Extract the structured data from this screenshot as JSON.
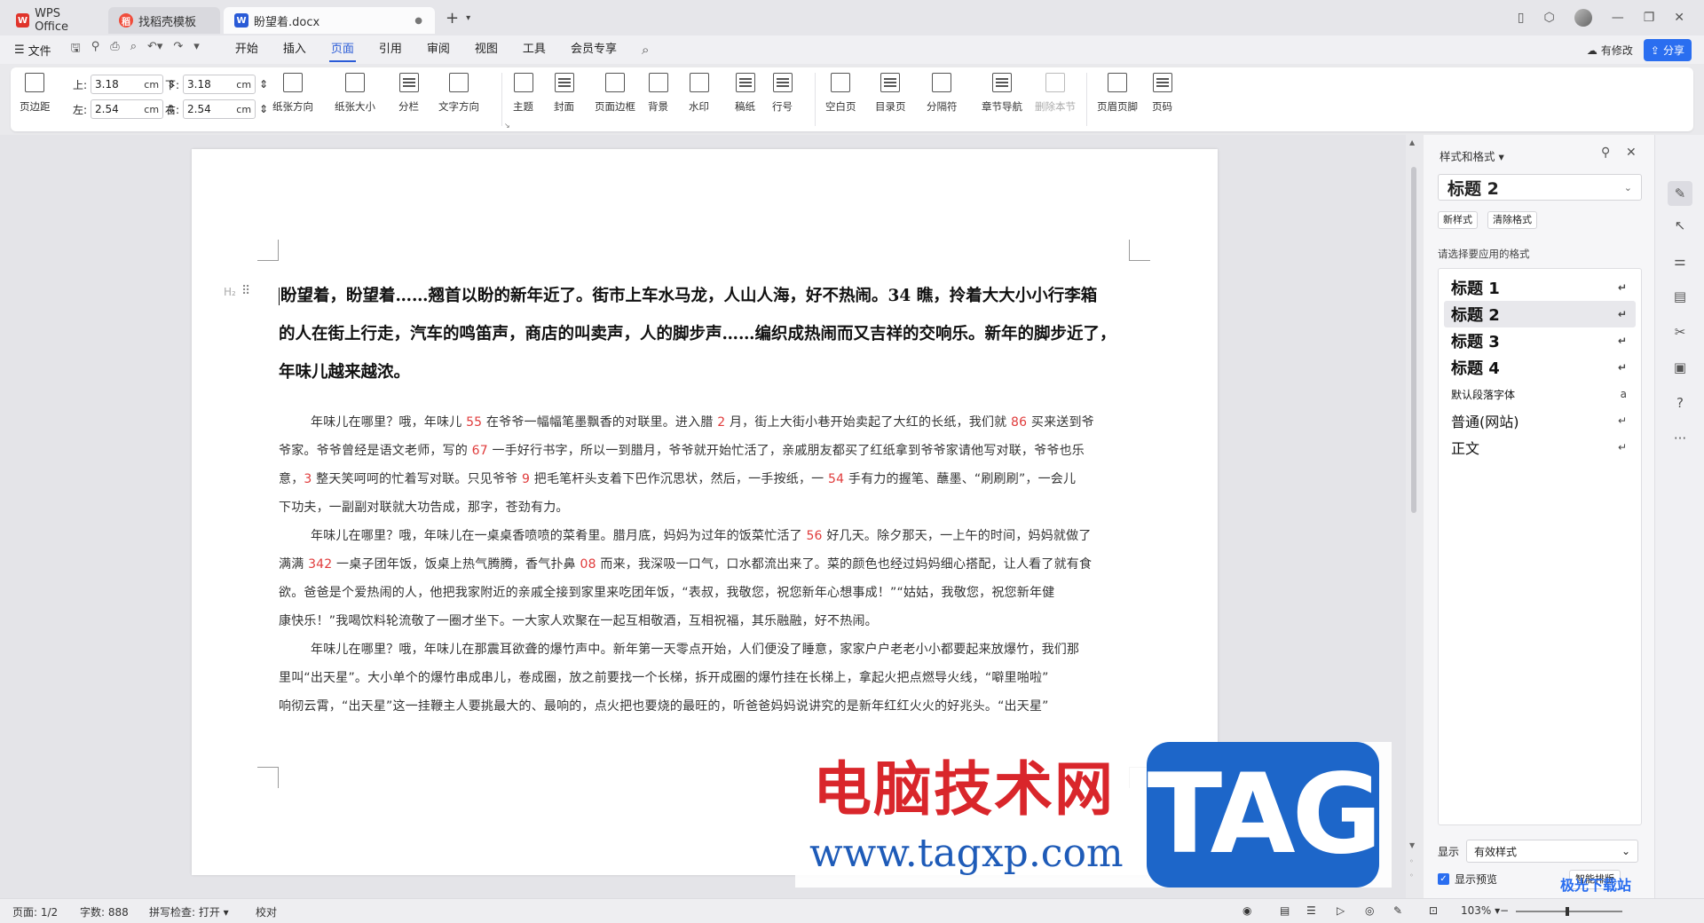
{
  "titlebar": {
    "tabs": [
      {
        "label": "WPS Office"
      },
      {
        "label": "找稻壳模板"
      },
      {
        "label": "盼望着.docx"
      }
    ]
  },
  "menubar": {
    "file": "文件",
    "tabs": [
      "开始",
      "插入",
      "页面",
      "引用",
      "审阅",
      "视图",
      "工具",
      "会员专享"
    ],
    "active_tab": "页面",
    "modified": "有修改",
    "share": "分享"
  },
  "ribbon": {
    "margins": {
      "label": "页边距",
      "top_label": "上:",
      "top": "3.18",
      "bottom_label": "下:",
      "bottom": "3.18",
      "left_label": "左:",
      "left": "2.54",
      "right_label": "右:",
      "right": "2.54",
      "unit": "cm"
    },
    "buttons": [
      "纸张方向",
      "纸张大小",
      "分栏",
      "文字方向",
      "主题",
      "封面",
      "页面边框",
      "背景",
      "水印",
      "稿纸",
      "行号",
      "空白页",
      "目录页",
      "分隔符",
      "章节导航",
      "删除本节",
      "页眉页脚",
      "页码"
    ]
  },
  "document": {
    "heading_lines": [
      "盼望着，盼望着……翘首以盼的新年近了。街市上车水马龙，人山人海，好不热闹。34 瞧，拎着大大小小行李箱",
      "的人在街上行走，汽车的鸣笛声，商店的叫卖声，人的脚步声……编织成热闹而又吉祥的交响乐。新年的脚步近了，",
      "年味儿越来越浓。"
    ],
    "body_lines": [
      [
        "年味儿在哪里？哦，年味儿 ",
        "55",
        " 在爷爷一幅幅笔墨飘香的对联里。进入腊 ",
        "2",
        " 月，街上大街小巷开始卖起了大红的长纸，我们就 ",
        "86",
        " 买来送到爷"
      ],
      [
        "爷家。爷爷曾经是语文老师，写的 ",
        "67",
        " 一手好行书字，所以一到腊月，爷爷就开始忙活了，亲戚朋友都买了红纸拿到爷爷家请他写对联，爷爷也乐"
      ],
      [
        "意，",
        "3",
        " 整天笑呵呵的忙着写对联。只见爷爷 ",
        "9",
        " 把毛笔杆头支着下巴作沉思状，然后，一手按纸，一 ",
        "54",
        " 手有力的握笔、蘸墨、“刷刷刷”，一会儿"
      ],
      [
        "下功夫，一副副对联就大功告成，那字，苍劲有力。"
      ],
      [
        "年味儿在哪里？哦，年味儿在一桌桌香喷喷的菜肴里。腊月底，妈妈为过年的饭菜忙活了 ",
        "56",
        " 好几天。除夕那天，一上午的时间，妈妈就做了"
      ],
      [
        "满满 ",
        "342",
        " 一桌子团年饭，饭桌上热气腾腾，香气扑鼻 ",
        "08",
        " 而来，我深吸一口气，口水都流出来了。菜的颜色也经过妈妈细心搭配，让人看了就有食"
      ],
      [
        "欲。爸爸是个爱热闹的人，他把我家附近的亲戚全接到家里来吃团年饭，“表叔，我敬您，祝您新年心想事成！”“姑姑，我敬您，祝您新年健"
      ],
      [
        "康快乐！”我喝饮料轮流敬了一圈才坐下。一大家人欢聚在一起互相敬酒，互相祝福，其乐融融，好不热闹。"
      ],
      [
        "年味儿在哪里？哦，年味儿在那震耳欲聋的爆竹声中。新年第一天零点开始，人们便没了睡意，家家户户老老小小都要起来放爆竹，我们那"
      ],
      [
        "里叫“出天星”。大小单个的爆竹串成串儿，卷成圈，放之前要找一个长梯，拆开成圈的爆竹挂在长梯上，拿起火把点燃导火线，“噼里啪啦”"
      ],
      [
        "响彻云霄，“出天星”这一挂鞭主人要挑最大的、最响的，点火把也要烧的最旺的，听爸爸妈妈说讲究的是新年红红火火的好兆头。“出天星”"
      ]
    ],
    "indent_rows": [
      0,
      4,
      8
    ],
    "h2_marker": "H₂",
    "number_color": "#e03b3b"
  },
  "styles_panel": {
    "title": "样式和格式",
    "current": "标题 2",
    "new_style": "新样式",
    "clear_format": "清除格式",
    "hint": "请选择要应用的格式",
    "items": [
      {
        "label": "标题 1",
        "kind": "h"
      },
      {
        "label": "标题 2",
        "kind": "h",
        "selected": true
      },
      {
        "label": "标题 3",
        "kind": "h"
      },
      {
        "label": "标题 4",
        "kind": "h"
      },
      {
        "label": "默认段落字体",
        "kind": "s"
      },
      {
        "label": "普通(网站)",
        "kind": "m"
      },
      {
        "label": "正文",
        "kind": "m"
      }
    ],
    "show_label": "显示",
    "show_value": "有效样式",
    "preview_label": "显示预览",
    "smart_btn": "智能排版"
  },
  "statusbar": {
    "page": "页面: 1/2",
    "words": "字数: 888",
    "spell": "拼写检查: 打开",
    "proof": "校对",
    "zoom": "103%"
  },
  "watermark": {
    "cn": "电脑技术网",
    "url": "www.tagxp.com",
    "tag": "TAG",
    "corner": "极光下载站"
  },
  "colors": {
    "accent": "#2a5bd7",
    "number_red": "#e03b3b",
    "watermark_red": "#d9262b",
    "watermark_blue": "#1d66c9"
  }
}
